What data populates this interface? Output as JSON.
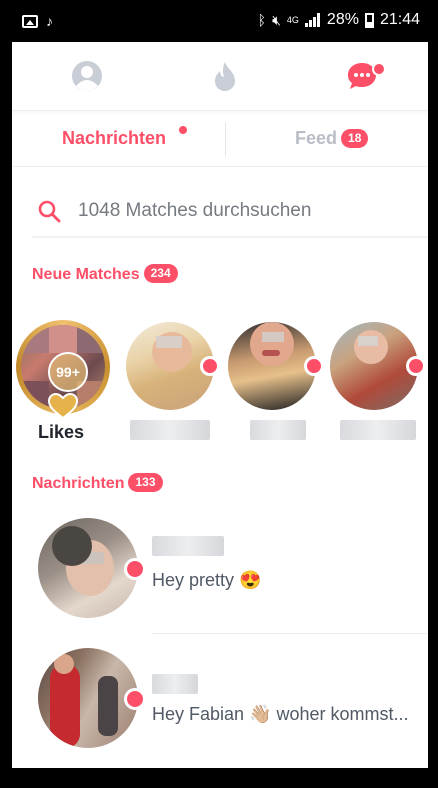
{
  "status_bar": {
    "network": "4G",
    "battery": "28%",
    "time": "21:44"
  },
  "tabs": {
    "messages_label": "Nachrichten",
    "feed_label": "Feed",
    "feed_count": "18"
  },
  "search": {
    "placeholder": "1048 Matches durchsuchen"
  },
  "new_matches": {
    "title": "Neue Matches",
    "count": "234",
    "likes_badge": "99+",
    "likes_label": "Likes"
  },
  "messages": {
    "title": "Nachrichten",
    "count": "133",
    "items": [
      {
        "preview": "Hey pretty 😍"
      },
      {
        "preview": "Hey Fabian 👋🏼 woher kommst..."
      }
    ]
  },
  "colors": {
    "accent": "#fd4f68",
    "inactive": "#b9bec6"
  }
}
